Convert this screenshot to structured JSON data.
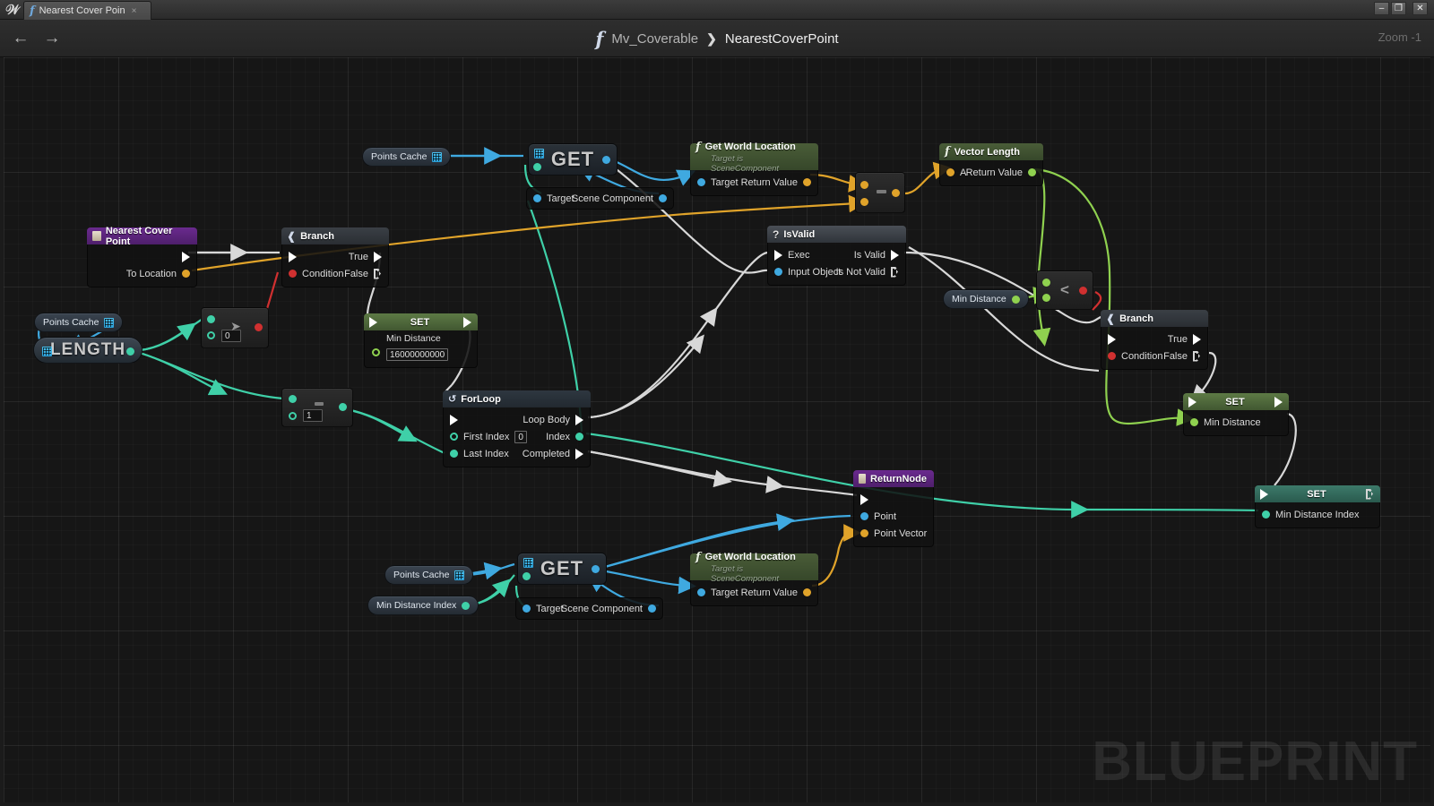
{
  "window": {
    "app_icon": "unreal-logo-icon",
    "tab_label": "Nearest Cover Poin",
    "tab_fn_icon": "function-icon",
    "tab_close_icon": "close-icon",
    "minimize_label": "–",
    "maximize_label": "❐",
    "close_label": "✕"
  },
  "toolbar": {
    "back_icon": "←",
    "forward_icon": "→",
    "breadcrumb_fn_icon": "function-icon",
    "breadcrumb_parent": "Mv_Coverable",
    "breadcrumb_separator": "❯",
    "breadcrumb_current": "NearestCoverPoint",
    "zoom_label": "Zoom -1"
  },
  "graph": {
    "watermark": "BLUEPRINT",
    "nodes": {
      "entry": {
        "title": "Nearest Cover Point",
        "out_param": "To Location"
      },
      "branch_main": {
        "title": "Branch",
        "condition": "Condition",
        "true": "True",
        "false": "False"
      },
      "points_cache_top": {
        "label": "Points Cache"
      },
      "points_cache_left": {
        "label": "Points Cache"
      },
      "points_cache_bottom": {
        "label": "Points Cache"
      },
      "length": {
        "label": "LENGTH"
      },
      "greater_node": {
        "glyph": "➤",
        "value": "0"
      },
      "subtract_node": {
        "glyph": "▬",
        "value": "1"
      },
      "get_top": {
        "label": "GET",
        "target": "Target",
        "scene_component": "Scene Component"
      },
      "get_bottom": {
        "label": "GET",
        "target": "Target",
        "scene_component": "Scene Component"
      },
      "get_world_location_top": {
        "title": "Get World Location",
        "subtitle": "Target is SceneComponent",
        "target": "Target",
        "return_value": "Return Value"
      },
      "get_world_location_bottom": {
        "title": "Get World Location",
        "subtitle": "Target is SceneComponent",
        "target": "Target",
        "return_value": "Return Value"
      },
      "vector_subtract": {
        "glyph": "▬"
      },
      "vector_length": {
        "title": "Vector Length",
        "a": "A",
        "return_value": "Return Value"
      },
      "isvalid": {
        "title": "IsValid",
        "title_icon": "?",
        "exec": "Exec",
        "input_object": "Input Object",
        "is_valid": "Is Valid",
        "is_not_valid": "Is Not Valid"
      },
      "min_distance_get": {
        "label": "Min Distance"
      },
      "less_than": {
        "glyph": "<"
      },
      "branch_right": {
        "title": "Branch",
        "condition": "Condition",
        "true": "True",
        "false": "False"
      },
      "set_min_distance_init": {
        "title": "SET",
        "param": "Min Distance",
        "value": "16000000000"
      },
      "set_min_distance": {
        "title": "SET",
        "param": "Min Distance"
      },
      "set_min_distance_index": {
        "title": "SET",
        "param": "Min Distance Index"
      },
      "forloop": {
        "title": "ForLoop",
        "title_icon": "loop-icon",
        "first_index": "First Index",
        "first_index_value": "0",
        "last_index": "Last Index",
        "loop_body": "Loop Body",
        "index": "Index",
        "completed": "Completed"
      },
      "return_node": {
        "title": "ReturnNode",
        "point": "Point",
        "point_vector": "Point Vector"
      },
      "min_distance_index_get": {
        "label": "Min Distance Index"
      }
    }
  },
  "colors": {
    "exec_wire": "#d8d8d8",
    "object_wire": "#3fa9e0",
    "vector_wire": "#e0a32a",
    "float_wire": "#8fd14f",
    "int_wire": "#3fd0a8",
    "bool_wire": "#d03030",
    "node_purple": "#6a2a8e",
    "node_function_green": "#4a5d38"
  }
}
